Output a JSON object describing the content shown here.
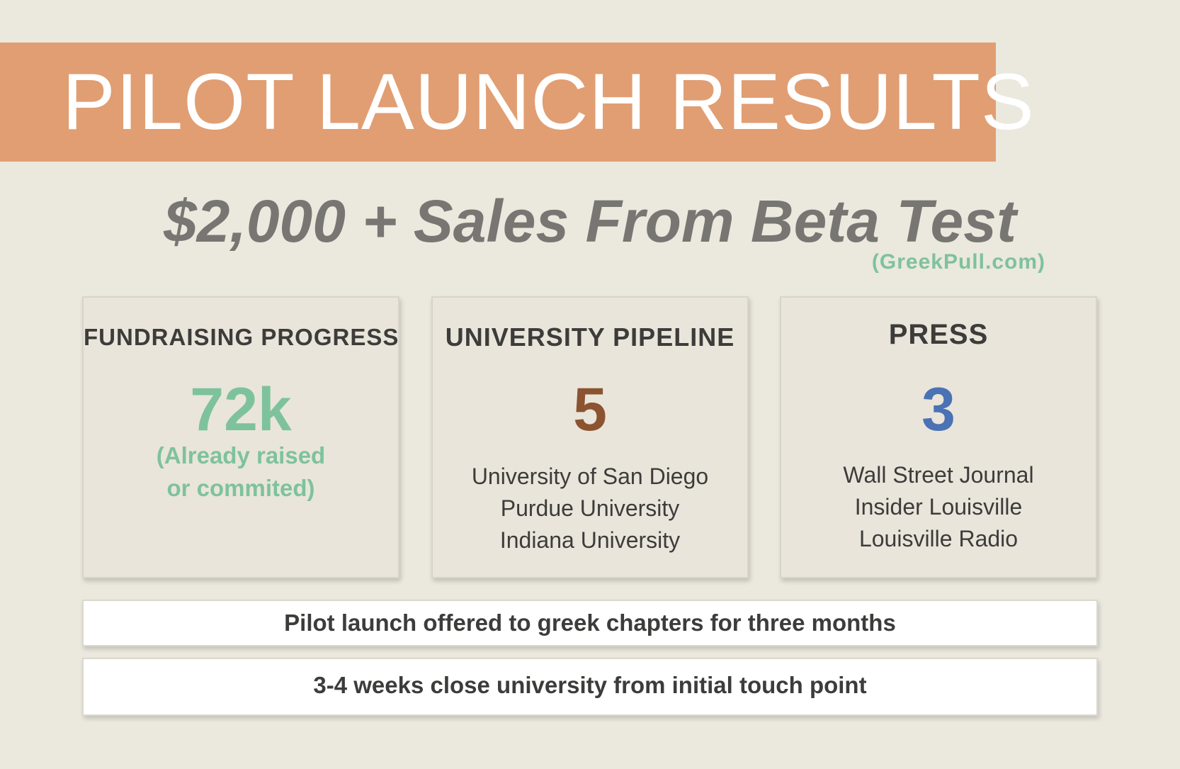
{
  "banner": {
    "title": "PILOT LAUNCH RESULTS"
  },
  "headline": {
    "text": "$2,000 + Sales From Beta Test",
    "source": "(GreekPull.com)"
  },
  "cards": [
    {
      "title": "FUNDRAISING PROGRESS",
      "value": "72k",
      "note": [
        "(Already raised",
        "or commited)"
      ]
    },
    {
      "title": "UNIVERSITY PIPELINE",
      "value": "5",
      "items": [
        "University of San Diego",
        "Purdue University",
        "Indiana University"
      ]
    },
    {
      "title": "PRESS",
      "value": "3",
      "items": [
        "Wall Street Journal",
        "Insider Louisville",
        "Louisville Radio"
      ]
    }
  ],
  "footer_bars": [
    "Pilot launch offered to greek chapters for three months",
    "3-4 weeks close university from initial touch point"
  ],
  "colors": {
    "background": "#ebe8de",
    "banner": "#e19e72",
    "green": "#7ec29c",
    "brown": "#8c5330",
    "blue": "#4a72b5",
    "headline_gray": "#787672"
  }
}
